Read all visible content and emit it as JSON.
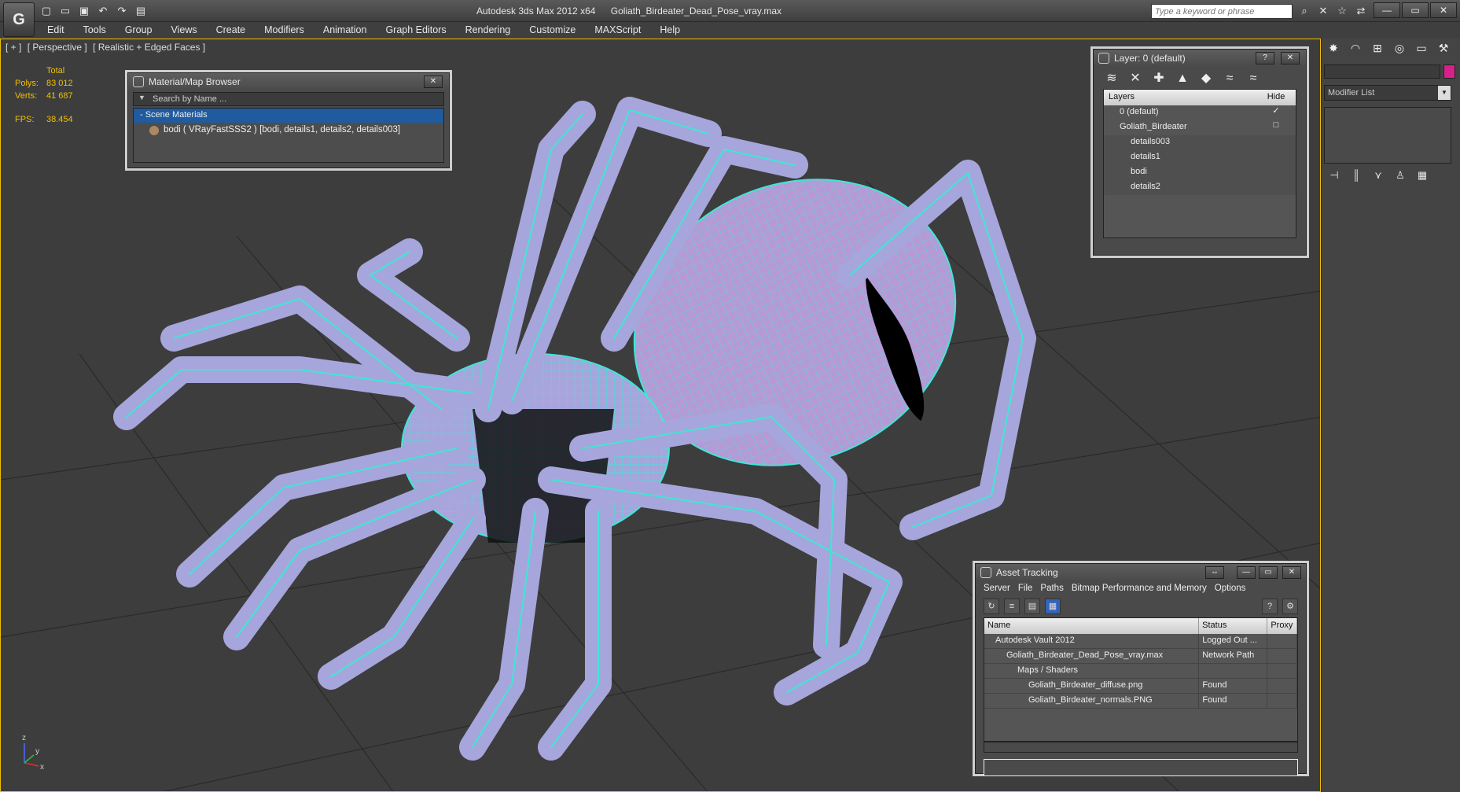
{
  "app": {
    "name": "Autodesk 3ds Max  2012 x64",
    "file": "Goliath_Birdeater_Dead_Pose_vray.max",
    "logo_glyph": "G"
  },
  "search": {
    "placeholder": "Type a keyword or phrase"
  },
  "menu": [
    "Edit",
    "Tools",
    "Group",
    "Views",
    "Create",
    "Modifiers",
    "Animation",
    "Graph Editors",
    "Rendering",
    "Customize",
    "MAXScript",
    "Help"
  ],
  "viewport": {
    "label": [
      "[ + ]",
      "[ Perspective ]",
      "[ Realistic + Edged Faces ]"
    ],
    "stats": {
      "total_label": "Total",
      "polys_label": "Polys:",
      "polys_value": "83 012",
      "verts_label": "Verts:",
      "verts_value": "41 687",
      "fps_label": "FPS:",
      "fps_value": "38.454"
    },
    "axis": {
      "z": "z",
      "x": "x",
      "y": "y"
    },
    "colors": {
      "wire": "#40e8d8",
      "mesh": "#a8a8e0",
      "border": "#f0c000"
    }
  },
  "material_browser": {
    "title": "Material/Map Browser",
    "search_placeholder": "Search by Name ...",
    "category": "- Scene Materials",
    "item": "bodi  ( VRayFastSSS2 ) [bodi, details1, details2, details003]"
  },
  "layer_window": {
    "title": "Layer: 0 (default)",
    "help_btn": "?",
    "close_btn": "✕",
    "col_layers": "Layers",
    "col_hide": "Hide",
    "rows": [
      {
        "name": "0 (default)",
        "check": "✓"
      },
      {
        "name": "Goliath_Birdeater",
        "check": "□"
      },
      {
        "name": "details003",
        "check": ""
      },
      {
        "name": "details1",
        "check": ""
      },
      {
        "name": "bodi",
        "check": ""
      },
      {
        "name": "details2",
        "check": ""
      }
    ]
  },
  "command_panel": {
    "modifier_list": "Modifier List",
    "object_color": "#d8208a"
  },
  "asset_tracking": {
    "title": "Asset Tracking",
    "menu": [
      "Server",
      "File",
      "Paths",
      "Bitmap Performance and Memory",
      "Options"
    ],
    "col_name": "Name",
    "col_status": "Status",
    "col_proxy": "Proxy",
    "rows": [
      {
        "name": "Autodesk Vault 2012",
        "status": "Logged Out ...",
        "indent": 1
      },
      {
        "name": "Goliath_Birdeater_Dead_Pose_vray.max",
        "status": "Network Path",
        "indent": 2
      },
      {
        "name": "Maps / Shaders",
        "status": "",
        "indent": 3
      },
      {
        "name": "Goliath_Birdeater_diffuse.png",
        "status": "Found",
        "indent": 4
      },
      {
        "name": "Goliath_Birdeater_normals.PNG",
        "status": "Found",
        "indent": 4
      }
    ]
  }
}
